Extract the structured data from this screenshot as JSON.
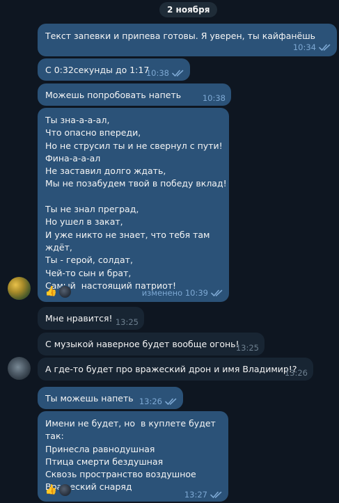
{
  "date_separator": "2 ноября",
  "messages": [
    {
      "text": "Текст запевки и припева готовы. Я уверен, ты кайфанёшь",
      "time": "10:34"
    },
    {
      "text": "С 0:32секунды до 1:17",
      "time": "10:38"
    },
    {
      "text": "Можешь попробовать напеть",
      "time": "10:38"
    },
    {
      "text": "Ты зна-а-а-ал,\nЧто опасно впереди,\nНо не струсил ты и не свернул с пути!\nФина-а-а-ал\nНе заставил долго ждать,\nМы не позабудем твой в победу вклад!\n\nТы не знал преград,\nНо ушел в закат,\nИ уже никто не знает, что тебя там ждёт,\nТы - герой, солдат,\nЧей-то сын и брат,\nСамый  настоящий патриот!",
      "time": "изменено 10:39",
      "reaction": "👍"
    },
    {
      "text": "Мне нравится!",
      "time": "13:25"
    },
    {
      "text": "С музыкой наверное будет вообще огонь!",
      "time": "13:25"
    },
    {
      "text": "А где-то будет про вражеский дрон и имя Владимир!?",
      "time": "13:26"
    },
    {
      "text": "Ты можешь напеть",
      "time": "13:26"
    },
    {
      "text": "Имени не будет, но  в куплете будет так:\nПринесла равнодушная\nПтица смерти бездушная\nСквозь пространство воздушное\nВражеский снаряд",
      "time": "13:27",
      "reaction": "👍"
    }
  ],
  "colors": {
    "background": "#0e1621",
    "outgoing_bubble": "#2b5278",
    "incoming_bubble": "#182533",
    "outgoing_meta": "#7da8d3",
    "incoming_meta": "#6d7f8f"
  },
  "icons": {
    "read_receipt": "double-check-icon",
    "reaction": "thumbs-up-icon"
  }
}
